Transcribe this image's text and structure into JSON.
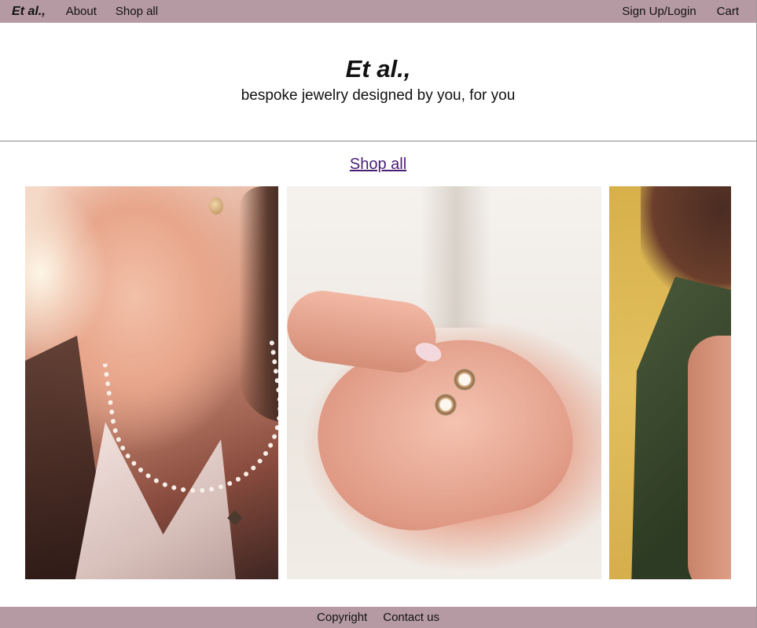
{
  "nav": {
    "brand": "Et al.,",
    "left_links": [
      "About",
      "Shop all"
    ],
    "right_links": [
      "Sign Up/Login",
      "Cart"
    ]
  },
  "hero": {
    "title": "Et al.,",
    "tagline": "bespoke jewelry designed by you, for you"
  },
  "main": {
    "shop_all_link": "Shop all"
  },
  "footer": {
    "links": [
      "Copyright",
      "Contact us"
    ]
  },
  "colors": {
    "nav_background": "#b69aa3",
    "footer_background": "#b69aa3",
    "link_accent": "#4a1e74"
  }
}
